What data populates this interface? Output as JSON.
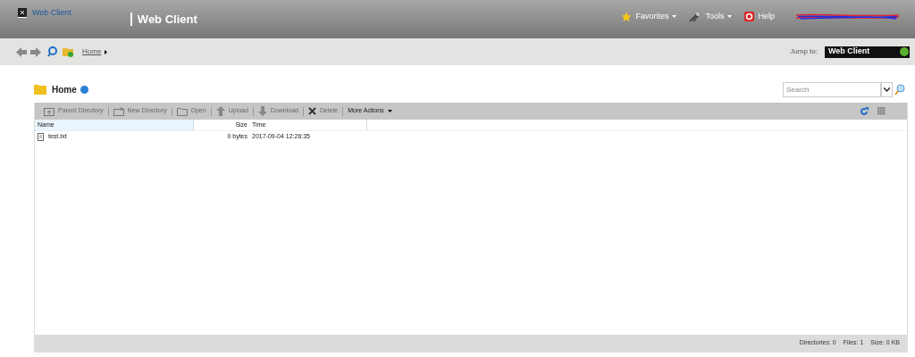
{
  "header": {
    "logo_text": "Web Client",
    "title": "Web Client",
    "menu": [
      {
        "label": "Favorites",
        "kind": "star"
      },
      {
        "label": "Tools",
        "kind": "tools"
      },
      {
        "label": "Help",
        "kind": "help"
      }
    ]
  },
  "nav": {
    "breadcrumb": "Home",
    "jump_label": "Jump to:",
    "jump_value": "Web Client"
  },
  "folder": {
    "title": "Home",
    "search": {
      "placeholder": "Search"
    }
  },
  "actions": [
    {
      "label": "Parent Directory",
      "kind": "parent",
      "disabled": true
    },
    {
      "label": "New Directory",
      "kind": "newdir",
      "disabled": true
    },
    {
      "label": "Open",
      "kind": "open",
      "disabled": true
    },
    {
      "label": "Upload",
      "kind": "upload",
      "disabled": true
    },
    {
      "label": "Download",
      "kind": "download",
      "disabled": true
    },
    {
      "label": "Delete",
      "kind": "delete",
      "disabled": true
    },
    {
      "label": "More Actions",
      "kind": "more",
      "disabled": false
    }
  ],
  "table": {
    "columns": [
      "Name",
      "Size",
      "Time"
    ],
    "rows": [
      {
        "name": "test.txt",
        "size": "0 bytes",
        "time": "2017-09-04 12:26:35"
      }
    ]
  },
  "status_bar": [
    "Directories: 0",
    "Files: 1",
    "Size: 0 KB"
  ]
}
